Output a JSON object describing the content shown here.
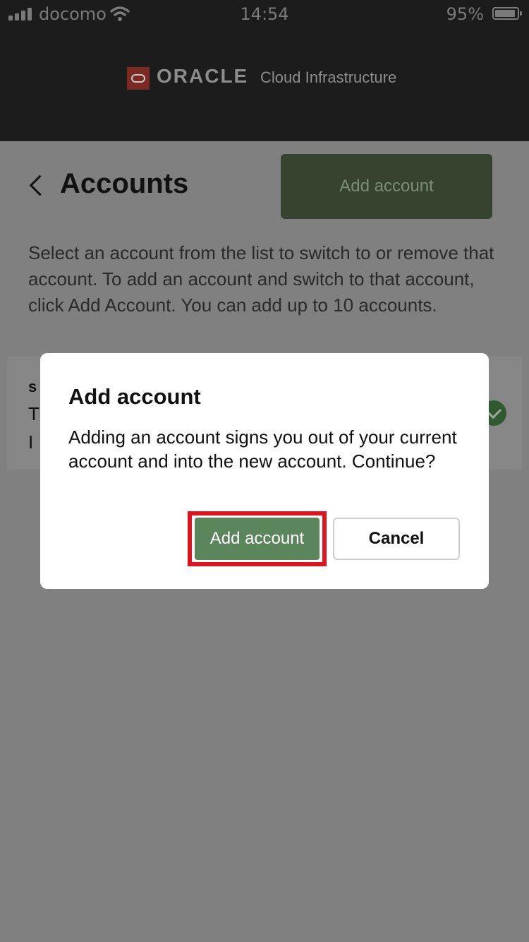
{
  "status_bar": {
    "carrier": "docomo",
    "time": "14:54",
    "battery_percent": "95%",
    "battery_level": 0.95
  },
  "brand": {
    "oracle": "ORACLE",
    "product": "Cloud Infrastructure",
    "accent_color": "#c74634"
  },
  "page": {
    "title": "Accounts",
    "add_account_label": "Add account",
    "description": "Select an account from the list to switch to or remove that account. To add an account and switch to that account, click Add Account. You can add up to 10 accounts."
  },
  "account_item": {
    "line1": "s",
    "line2": "T",
    "line3": "I"
  },
  "dialog": {
    "title": "Add account",
    "message": "Adding an account signs you out of your current account and into the new account. Continue?",
    "confirm_label": "Add account",
    "cancel_label": "Cancel",
    "confirm_color": "#5b855a",
    "highlight_color": "#e0141e"
  }
}
